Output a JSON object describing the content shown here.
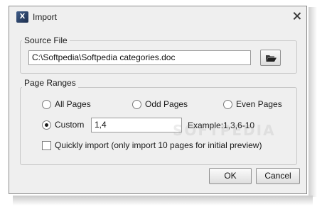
{
  "window": {
    "title": "Import",
    "icon": "app-x-icon",
    "icon_glyph": "X"
  },
  "source_file": {
    "label": "Source File",
    "path_value": "C:\\Softpedia\\Softpedia categories.doc",
    "browse_icon": "folder-open-icon"
  },
  "page_ranges": {
    "label": "Page Ranges",
    "options": {
      "all": {
        "label": "All Pages",
        "checked": false
      },
      "odd": {
        "label": "Odd Pages",
        "checked": false
      },
      "even": {
        "label": "Even Pages",
        "checked": false
      },
      "custom": {
        "label": "Custom",
        "checked": true
      }
    },
    "custom_value": "1,4",
    "example_text": "Example:1,3,6-10",
    "quick_import": {
      "label": "Quickly import (only import 10 pages for initial preview)",
      "checked": false
    }
  },
  "buttons": {
    "ok": "OK",
    "cancel": "Cancel"
  },
  "watermark_text": "SOFTPEDIA"
}
